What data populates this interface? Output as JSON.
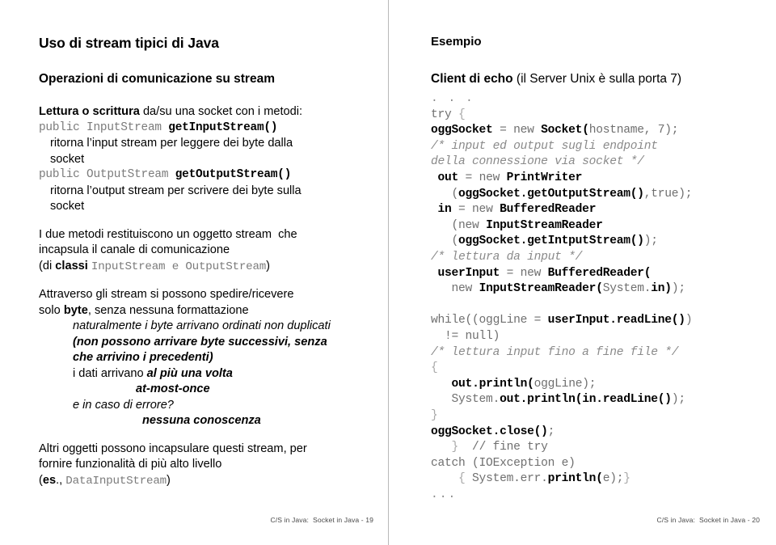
{
  "left_slide": {
    "title": "Uso di stream tipici di Java",
    "subhead": "Operazioni di comunicazione su stream",
    "intro_bold": "Lettura o scrittura",
    "intro_rest": " da/su una socket con i metodi:",
    "method1_code_pre": "public InputStream ",
    "method1_code_name": "getInputStream",
    "method1_code_post": "()",
    "method1_desc_l1": "ritorna l’input stream per leggere dei byte dalla",
    "method1_desc_l2": "socket",
    "method2_code_pre": "public OutputStream ",
    "method2_code_name": "getOutputStream",
    "method2_code_post": "()",
    "method2_desc_l1": "ritorna l’output stream per scrivere dei byte sulla",
    "method2_desc_l2": "socket",
    "para2_l1": "I due metodi restituiscono un oggetto stream  che",
    "para2_l2": "incapsula il canale di comunicazione",
    "para2_l3_pre": "(di ",
    "para2_l3_bold": "classi ",
    "para2_l3_code1": "InputStream",
    "para2_l3_mid": " e ",
    "para2_l3_code2": "OutputStream",
    "para2_l3_post": ")",
    "para3_l1": "Attraverso gli stream si possono spedire/ricevere",
    "para3_l2_pre": "solo ",
    "para3_l2_bold": "byte",
    "para3_l2_post": ", senza nessuna formattazione",
    "para3_l3": "naturalmente i byte arrivano ordinati non duplicati",
    "para3_l4": "(non possono arrivare byte successivi, senza",
    "para3_l5": "che arrivino i precedenti)",
    "para3_l6_pre": "i dati arrivano ",
    "para3_l6_bold": "al più una volta",
    "para3_l7": "at-most-once",
    "para3_l8": "e in caso di errore?",
    "para3_l9": "nessuna conoscenza",
    "para4_l1": "Altri oggetti possono incapsulare questi stream, per",
    "para4_l2": "fornire funzionalità di più alto livello",
    "para4_l3_pre": "(",
    "para4_l3_bold": "es",
    "para4_l3_mid": "., ",
    "para4_l3_code": "DataInputStream",
    "para4_l3_post": ")",
    "footer": "C/S in Java:  Socket in Java - 19"
  },
  "right_slide": {
    "title": "Esempio",
    "subhead_bold": "Client di echo",
    "subhead_rest": " (il Server Unix è sulla porta 7)",
    "code_lines": [
      ". . .",
      "try {",
      "oggSocket = new Socket(hostname, 7);",
      "/* input ed output sugli endpoint",
      "della connessione via socket */",
      " out = new PrintWriter",
      "   (oggSocket.getOutputStream(),true);",
      " in = new BufferedReader",
      "   (new InputStreamReader",
      "   (oggSocket.getIntputStream());",
      "/* lettura da input */",
      " userInput = new BufferedReader(",
      "   new InputStreamReader(System.in));",
      "",
      "while((oggLine = userInput.readLine())",
      "  != null)",
      "/* lettura input fino a fine file */",
      "{",
      "   out.println(oggLine);",
      "   System.out.println(in.readLine());",
      "}",
      "oggSocket.close();",
      "   }  // fine try",
      "catch (IOException e)",
      "    { System.err.println(e);}",
      "..."
    ],
    "footer": "C/S in Java:  Socket in Java - 20"
  }
}
